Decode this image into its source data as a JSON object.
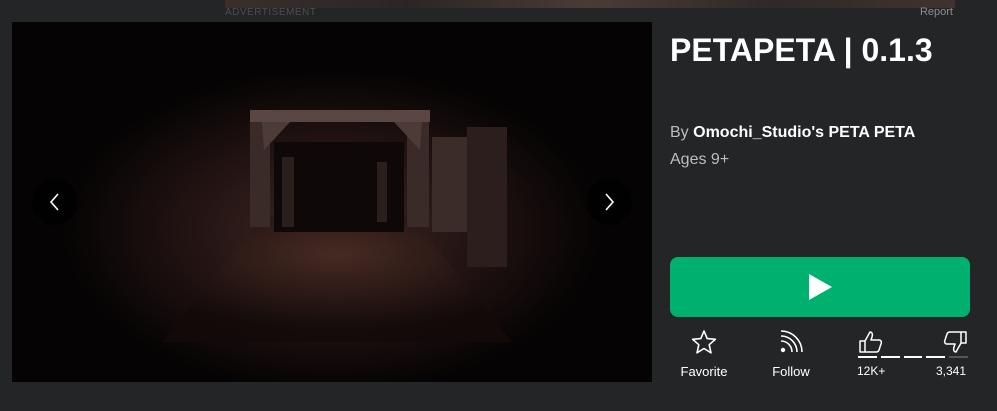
{
  "ad": {
    "label": "ADVERTISEMENT",
    "report": "Report"
  },
  "game": {
    "title": "PETAPETA | 0.1.3",
    "by_prefix": "By",
    "creator": "Omochi_Studio's PETA PETA",
    "ages": "Ages 9+"
  },
  "actions": {
    "favorite": "Favorite",
    "follow": "Follow",
    "upvotes": "12K+",
    "downvotes": "3,341"
  },
  "icons": {
    "prev": "chevron-left-icon",
    "next": "chevron-right-icon",
    "play": "play-icon",
    "favorite": "star-icon",
    "follow": "rss-icon",
    "upvote": "thumbs-up-icon",
    "downvote": "thumbs-down-icon"
  },
  "colors": {
    "play_button": "#00b06f",
    "background": "#232527"
  }
}
